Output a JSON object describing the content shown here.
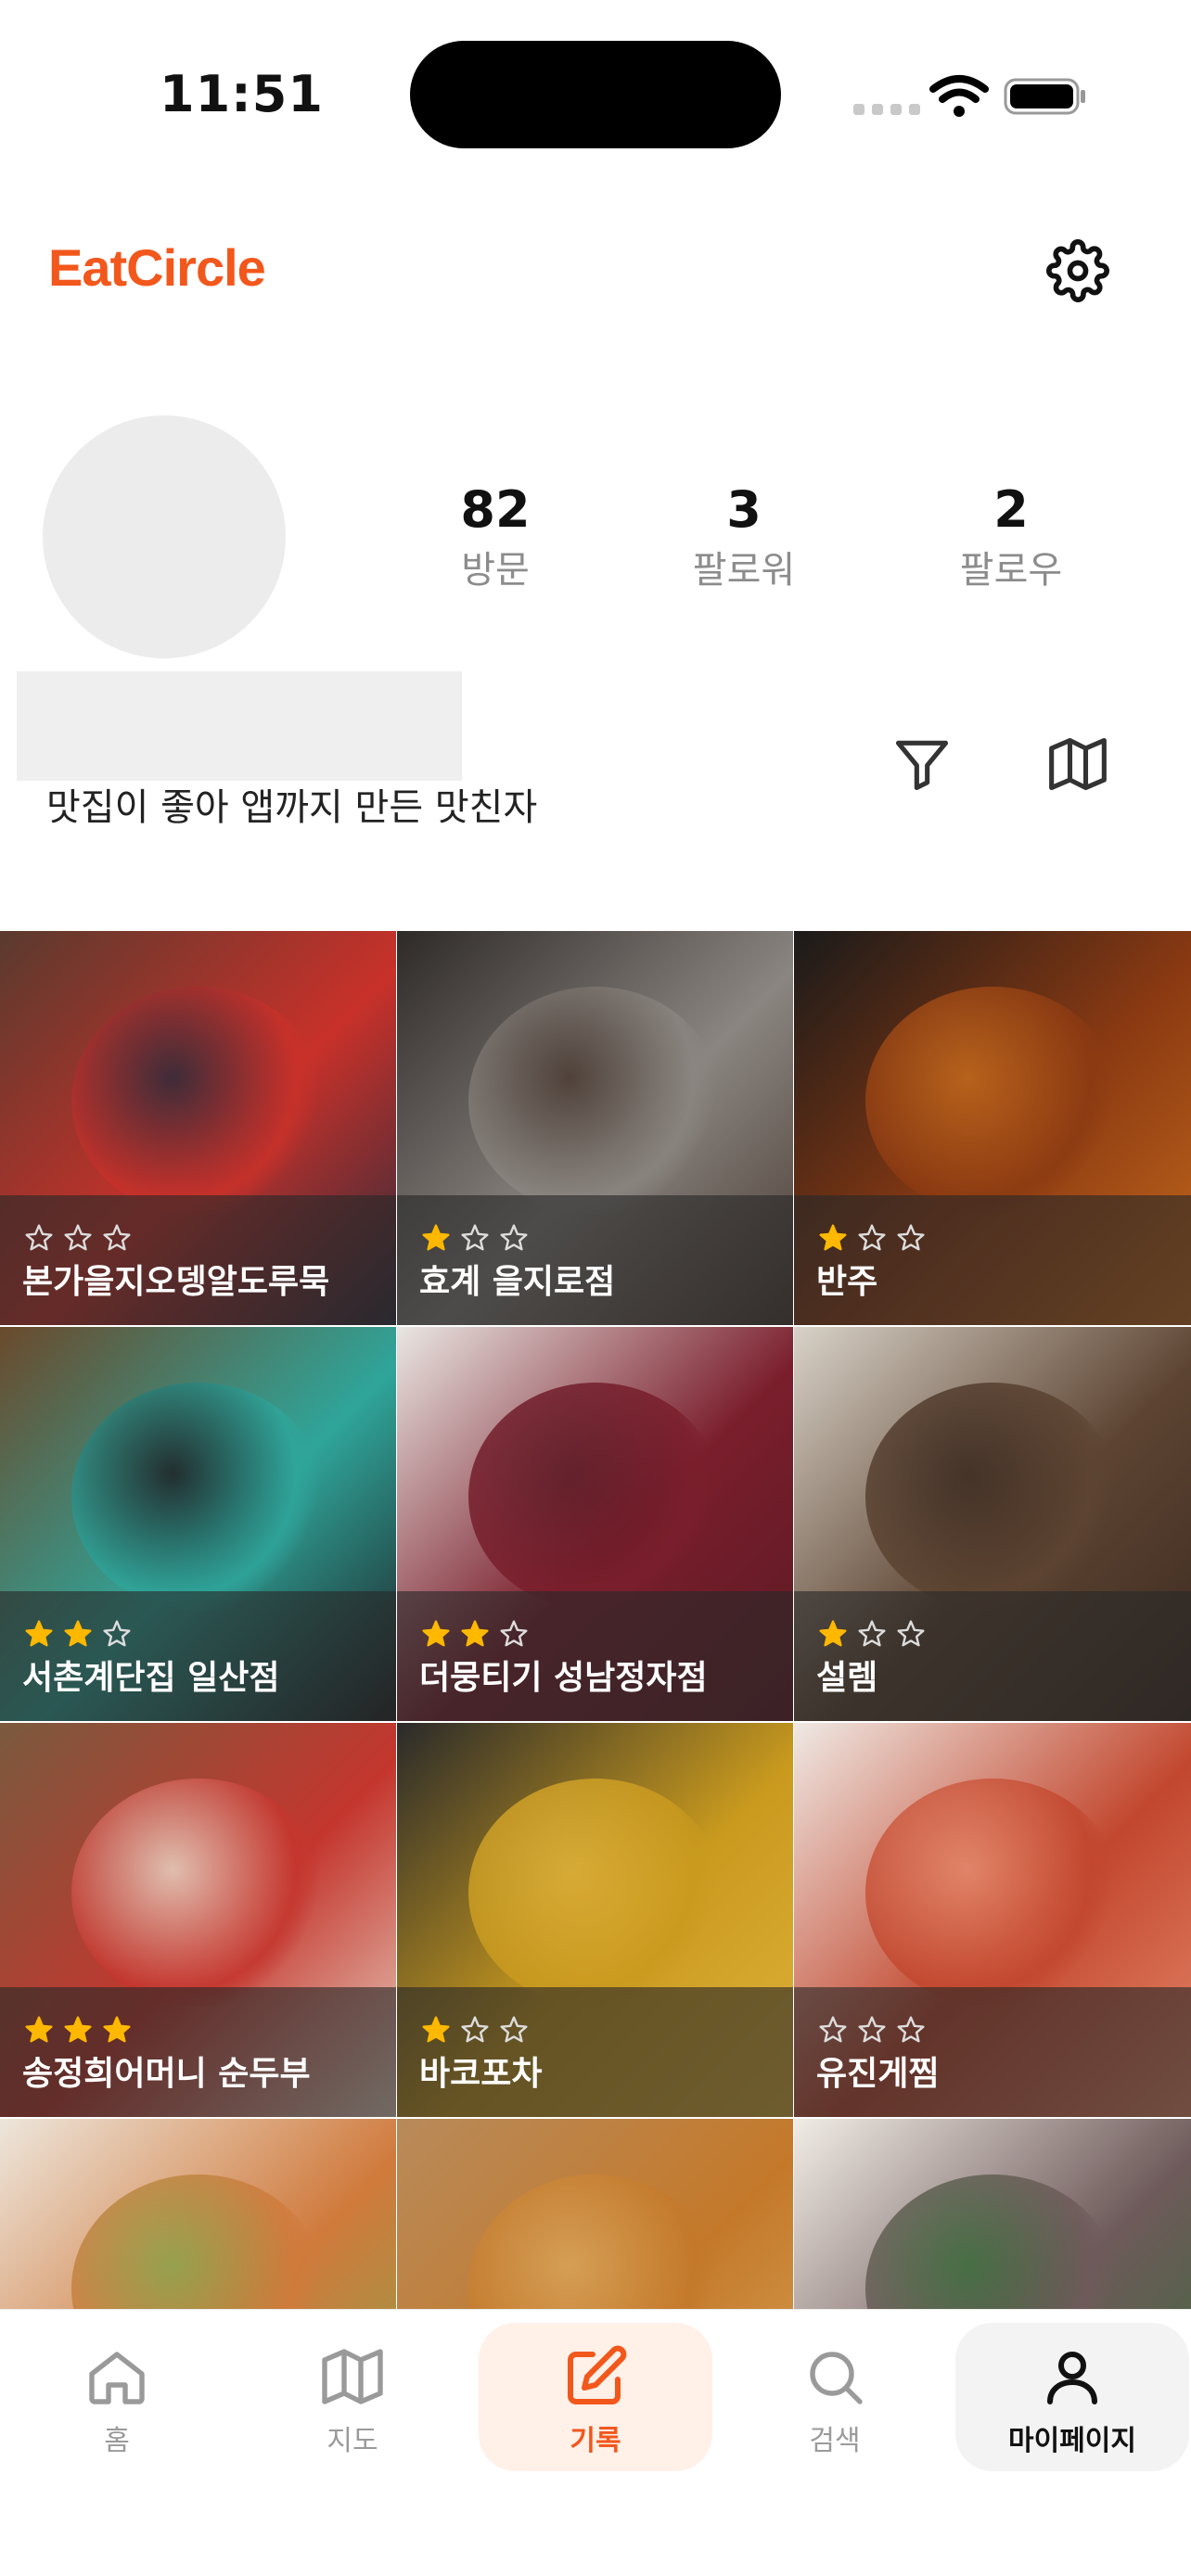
{
  "status_bar": {
    "time": "11:51"
  },
  "header": {
    "app_title": "EatCircle",
    "settings_icon": "gear-icon"
  },
  "profile": {
    "stats": [
      {
        "value": "82",
        "label": "방문"
      },
      {
        "value": "3",
        "label": "팔로워"
      },
      {
        "value": "2",
        "label": "팔로우"
      }
    ],
    "bio": "맛집이 좋아 앱까지 만든 맛친자",
    "actions": {
      "filter_icon": "filter-icon",
      "map_icon": "map-icon"
    }
  },
  "colors": {
    "accent": "#F2571C",
    "star": "#FFB800"
  },
  "restaurants": [
    {
      "name": "본가을지오뎅알도루묵",
      "rating": 0
    },
    {
      "name": "효계 을지로점",
      "rating": 1
    },
    {
      "name": "반주",
      "rating": 1
    },
    {
      "name": "서촌계단집 일산점",
      "rating": 2
    },
    {
      "name": "더뭉티기 성남정자점",
      "rating": 2
    },
    {
      "name": "설렘",
      "rating": 1
    },
    {
      "name": "송정희어머니 순두부",
      "rating": 3
    },
    {
      "name": "바코포차",
      "rating": 1
    },
    {
      "name": "유진게찜",
      "rating": 0
    },
    {
      "name": "",
      "rating": null
    },
    {
      "name": "",
      "rating": null
    },
    {
      "name": "",
      "rating": null
    }
  ],
  "tabbar": {
    "tabs": [
      {
        "label": "홈",
        "icon": "home-icon"
      },
      {
        "label": "지도",
        "icon": "map-icon"
      },
      {
        "label": "기록",
        "icon": "edit-icon"
      },
      {
        "label": "검색",
        "icon": "search-icon"
      },
      {
        "label": "마이페이지",
        "icon": "user-icon"
      }
    ]
  }
}
